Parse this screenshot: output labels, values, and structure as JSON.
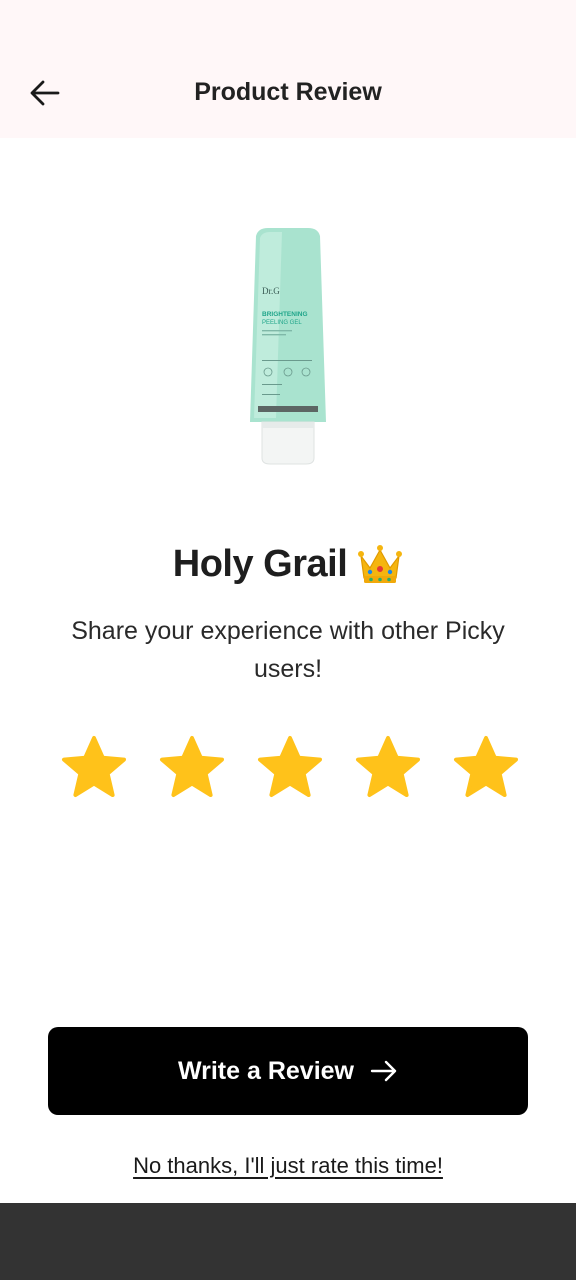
{
  "header": {
    "title": "Product Review",
    "back_icon": "arrow-left-icon"
  },
  "product": {
    "brand": "Dr.G",
    "name_line1": "BRIGHTENING",
    "name_line2": "PEELING GEL"
  },
  "rating": {
    "label": "Holy Grail",
    "emoji_icon": "crown-icon",
    "prompt": "Share your experience with other Picky users!",
    "value": 5,
    "max": 5,
    "star_color": "#FFC21A"
  },
  "actions": {
    "write_review_label": "Write a Review",
    "write_review_icon": "arrow-right-icon",
    "skip_label": "No thanks, I'll just rate this time!"
  },
  "colors": {
    "header_bg": "#FFF7F8",
    "button_bg": "#000000",
    "bottom_bar": "#333333"
  }
}
